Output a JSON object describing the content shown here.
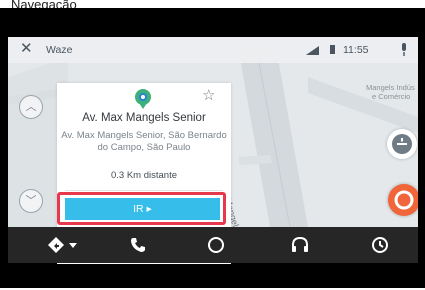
{
  "caption": "Navegação",
  "statusbar": {
    "close_icon": "close-icon",
    "app_title": "Waze",
    "time": "11:55",
    "icons": [
      "signal-icon",
      "battery-icon",
      "microphone-icon"
    ]
  },
  "card": {
    "title": "Av. Max Mangels Senior",
    "address": "Av. Max Mangels Senior, São Bernardo do Campo, São Paulo",
    "distance": "0.3 Km distante",
    "go_label": "IR ▸",
    "pin_icon": "location-pin-icon",
    "favorite_icon": "star-outline-icon"
  },
  "map": {
    "street_label": "R. Max Mangels Senior",
    "poi_label_line1": "Mangels Indús",
    "poi_label_line2": "e Comércio"
  },
  "navbar": {
    "items": [
      "navigation-icon",
      "phone-icon",
      "home-circle-icon",
      "headphones-icon",
      "history-icon"
    ]
  },
  "colors": {
    "go_button": "#36bdea",
    "highlight": "#e63a4c",
    "report_button": "#f0663a",
    "navbar": "#262626"
  }
}
